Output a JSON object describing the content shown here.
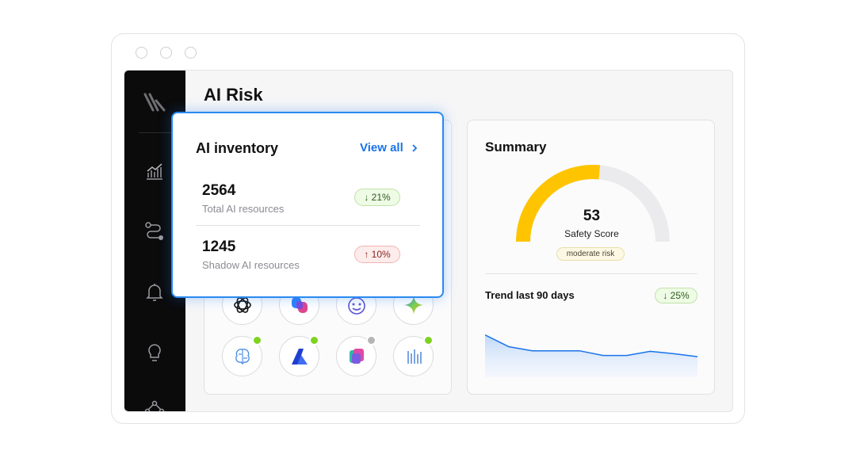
{
  "window": {
    "controls": [
      "close",
      "minimize",
      "maximize"
    ]
  },
  "sidebar": {
    "logo": "brand-logo-icon",
    "items": [
      {
        "icon": "chart-icon",
        "active": false
      },
      {
        "icon": "workflow-icon",
        "active": false
      },
      {
        "icon": "bell-icon",
        "active": false
      },
      {
        "icon": "lightbulb-icon",
        "active": false
      },
      {
        "icon": "network-icon",
        "active": false
      }
    ]
  },
  "main": {
    "title": "AI Risk"
  },
  "inventory": {
    "title": "AI inventory",
    "view_all": "View all",
    "metrics": [
      {
        "value": "2564",
        "label": "Total AI resources",
        "change": "↓ 21%"
      },
      {
        "value": "1245",
        "label": "Shadow AI resources",
        "change": "↑ 10%"
      }
    ],
    "ai_tools": [
      {
        "icon": "openai-icon",
        "status": null
      },
      {
        "icon": "copilot-icon",
        "status": null
      },
      {
        "icon": "smiley-bot-icon",
        "status": null
      },
      {
        "icon": "gemini-icon",
        "status": null
      },
      {
        "icon": "brain-circuit-icon",
        "status": "#7ed321"
      },
      {
        "icon": "azure-icon",
        "status": "#7ed321"
      },
      {
        "icon": "copilot-studio-icon",
        "status": "#b5b5b8"
      },
      {
        "icon": "data-stack-icon",
        "status": "#7ed321"
      }
    ]
  },
  "summary": {
    "title": "Summary",
    "score": "53",
    "score_label": "Safety Score",
    "score_value": 53,
    "score_max": 100,
    "risk_tag": "moderate risk",
    "trend_label": "Trend last 90 days",
    "trend_change": "↓ 25%",
    "trend": [
      72,
      52,
      45,
      45,
      45,
      37,
      37,
      44,
      40,
      35
    ],
    "trend_max": 100
  },
  "colors": {
    "accent": "#1a73e8",
    "gauge_fill": "#ffc400",
    "gauge_track": "#ebebee",
    "positive": "#7ed321",
    "negative": "#e54848"
  }
}
